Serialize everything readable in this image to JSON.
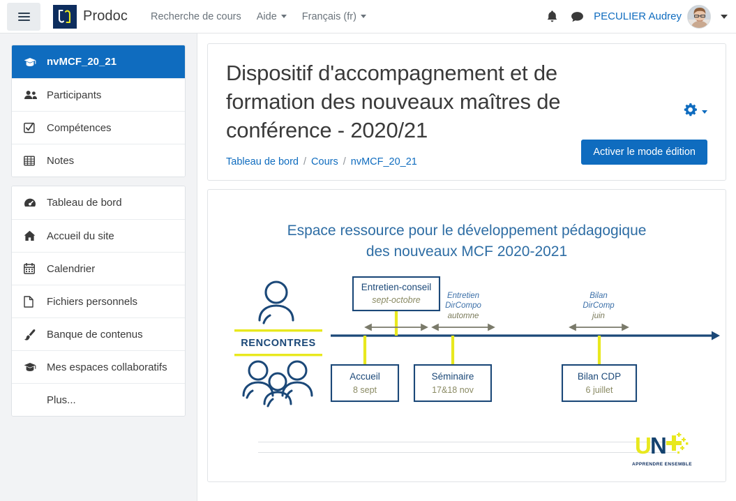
{
  "navbar": {
    "drawer_toggle_name": "hamburger-menu",
    "brand": "Prodoc",
    "links": [
      {
        "label": "Recherche de cours",
        "has_caret": false
      },
      {
        "label": "Aide",
        "has_caret": true
      },
      {
        "label": "Français (fr)",
        "has_caret": true
      }
    ],
    "notifications_icon": "bell-icon",
    "messages_icon": "chat-bubble-icon",
    "user_name": "PECULIER Audrey"
  },
  "sidebar": {
    "groups": [
      {
        "items": [
          {
            "label": "nvMCF_20_21",
            "icon": "graduation-cap-icon",
            "active": true
          },
          {
            "label": "Participants",
            "icon": "users-icon",
            "active": false
          },
          {
            "label": "Compétences",
            "icon": "check-square-icon",
            "active": false
          },
          {
            "label": "Notes",
            "icon": "table-icon",
            "active": false
          }
        ]
      },
      {
        "items": [
          {
            "label": "Tableau de bord",
            "icon": "dashboard-icon",
            "active": false
          },
          {
            "label": "Accueil du site",
            "icon": "home-icon",
            "active": false
          },
          {
            "label": "Calendrier",
            "icon": "calendar-icon",
            "active": false
          },
          {
            "label": "Fichiers personnels",
            "icon": "file-icon",
            "active": false
          },
          {
            "label": "Banque de contenus",
            "icon": "paint-brush-icon",
            "active": false
          },
          {
            "label": "Mes espaces collaboratifs",
            "icon": "graduation-cap-icon",
            "active": false
          },
          {
            "label": "Plus...",
            "icon": "none",
            "active": false
          }
        ]
      }
    ]
  },
  "header_card": {
    "title": "Dispositif d'accompagnement et de formation des nouveaux maîtres de conférence - 2020/21",
    "gear_icon": "gear-icon",
    "breadcrumb": [
      {
        "label": "Tableau de bord"
      },
      {
        "label": "Cours"
      },
      {
        "label": "nvMCF_20_21"
      }
    ],
    "breadcrumb_separator": "/",
    "edit_button": "Activer le mode édition"
  },
  "content_card": {
    "heading_line1": "Espace ressource pour le développement pédagogique",
    "heading_line2": "des nouveaux MCF 2020-2021",
    "diagram": {
      "section_label": "RENCONTRES",
      "person_icon": "person-icon",
      "group_icon": "people-group-icon",
      "boxes_above": [
        {
          "title": "Entretien-conseil",
          "date": "sept-octobre"
        }
      ],
      "boxes_below": [
        {
          "title": "Accueil",
          "date": "8 sept"
        },
        {
          "title": "Séminaire",
          "date": "17&18 nov"
        },
        {
          "title": "Bilan CDP",
          "date": "6 juillet"
        }
      ],
      "interval_labels": [
        {
          "line1": "Entretien",
          "line2": "DirCompo",
          "line3": "automne"
        },
        {
          "line1": "Bilan",
          "line2": "DirComp",
          "line3": "juin"
        }
      ]
    },
    "logo": {
      "text_u": "U",
      "text_n": "N",
      "tagline": "APPRENDRE ENSEMBLE"
    }
  },
  "colors": {
    "brand_blue": "#0f6cbf",
    "navy": "#0d2d5e",
    "yellow": "#e8e81e",
    "diagram_blue": "#2e6da4",
    "sidebar_bg": "#f2f3f5",
    "date_text": "#8a8a63"
  }
}
